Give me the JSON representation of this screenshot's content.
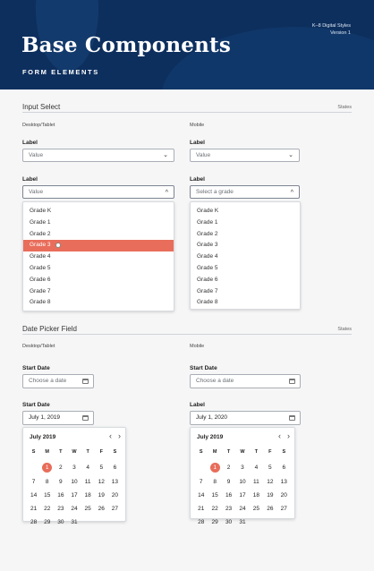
{
  "header": {
    "org": "K–8 Digital Styles",
    "version": "Version 1",
    "title": "Base Components",
    "subtitle": "FORM ELEMENTS"
  },
  "input_select": {
    "section_title": "Input Select",
    "states": "States",
    "desktop_label": "Desktop/Tablet",
    "mobile_label": "Mobile",
    "field_label": "Label",
    "value": "Value",
    "mobile_placeholder": "Select a grade",
    "options": [
      "Grade K",
      "Grade 1",
      "Grade 2",
      "Grade 3",
      "Grade 4",
      "Grade 5",
      "Grade 6",
      "Grade 7",
      "Grade 8"
    ],
    "selected_option": "Grade 3"
  },
  "date_picker": {
    "section_title": "Date Picker Field",
    "states": "States",
    "desktop_label": "Desktop/Tablet",
    "mobile_label": "Mobile",
    "field_label": "Start Date",
    "mobile_open_label": "Label",
    "placeholder": "Choose a date",
    "desktop_value": "July 1, 2019",
    "mobile_value": "July 1, 2020",
    "month": "July 2019",
    "weekdays": [
      "S",
      "M",
      "T",
      "W",
      "T",
      "F",
      "S"
    ],
    "first_day_offset": 1,
    "days_in_month": 31,
    "selected_day": 1
  },
  "colors": {
    "header_bg": "#0d2f5e",
    "accent": "#e86d5a"
  },
  "icons": [
    "chevron-down-icon",
    "chevron-up-icon",
    "calendar-icon",
    "chevron-left-icon",
    "chevron-right-icon",
    "cursor-icon"
  ]
}
